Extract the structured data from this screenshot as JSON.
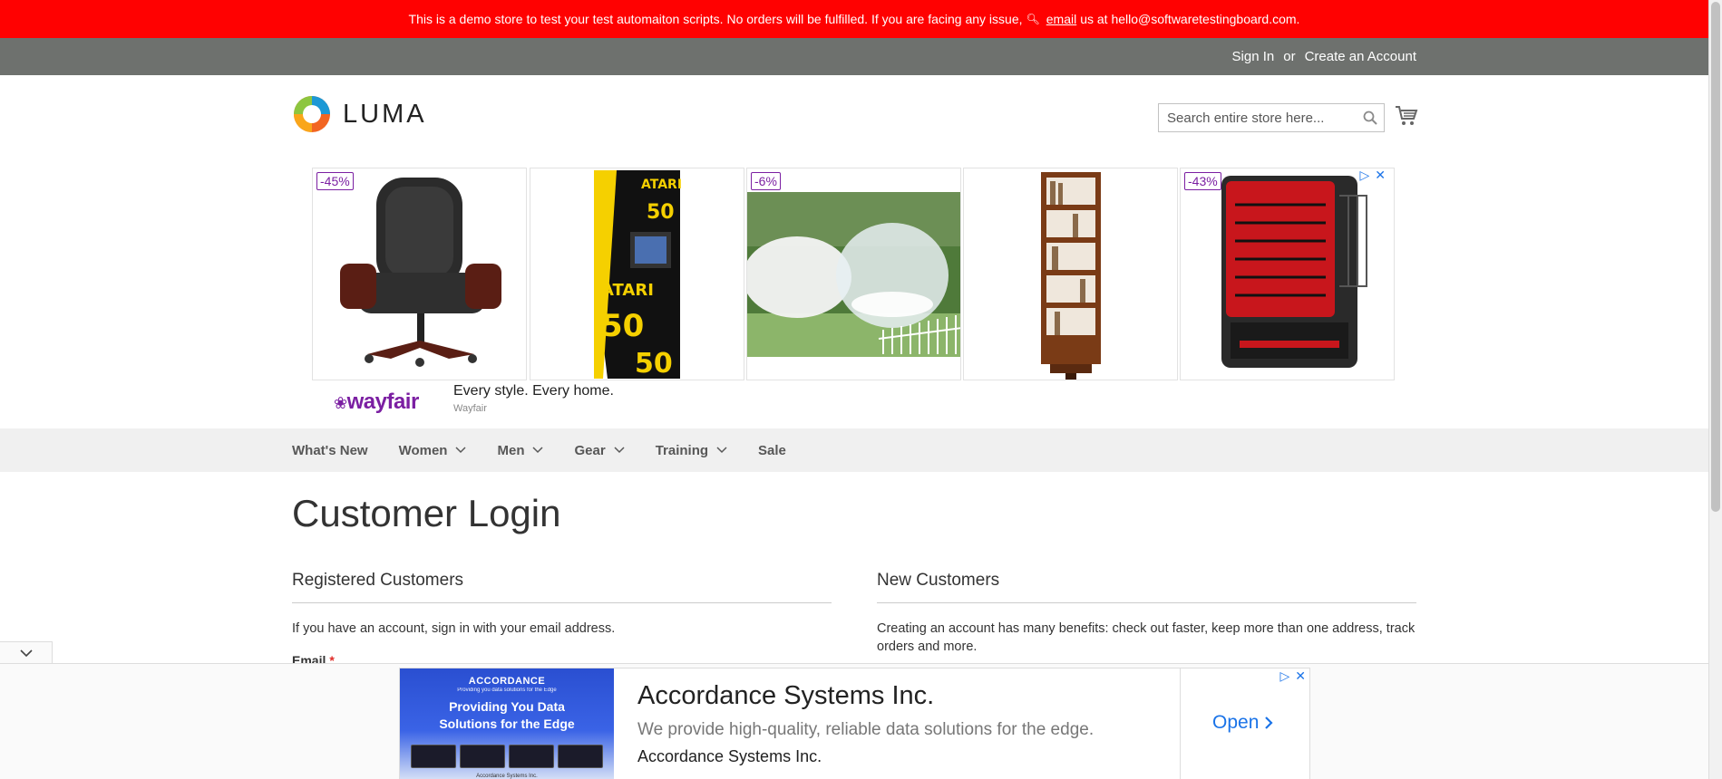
{
  "demo_notice": {
    "text_before": "This is a demo store to test your test automaiton scripts. No orders will be fulfilled. If you are facing any issue,",
    "email_link": "email",
    "text_after": "us at hello@softwaretestingboard.com.",
    "bg_color": "#ff0101"
  },
  "header": {
    "sign_in": "Sign In",
    "or": "or",
    "create_account": "Create an Account"
  },
  "logo": {
    "text": "LUMA"
  },
  "search": {
    "placeholder": "Search entire store here..."
  },
  "top_ad": {
    "tiles": [
      {
        "badge": "-45%",
        "product": "office-chair"
      },
      {
        "badge": "",
        "product": "atari-arcade"
      },
      {
        "badge": "-6%",
        "product": "bubble-tent"
      },
      {
        "badge": "",
        "product": "bookshelf"
      },
      {
        "badge": "-43%",
        "product": "heater"
      }
    ],
    "brand": "wayfair",
    "slogan": "Every style. Every home.",
    "source": "Wayfair"
  },
  "nav": {
    "items": [
      {
        "label": "What's New",
        "has_dropdown": false
      },
      {
        "label": "Women",
        "has_dropdown": true
      },
      {
        "label": "Men",
        "has_dropdown": true
      },
      {
        "label": "Gear",
        "has_dropdown": true
      },
      {
        "label": "Training",
        "has_dropdown": true
      },
      {
        "label": "Sale",
        "has_dropdown": false
      }
    ]
  },
  "page_title": "Customer Login",
  "registered": {
    "title": "Registered Customers",
    "text": "If you have an account, sign in with your email address.",
    "email_label": "Email",
    "required_marker": "*"
  },
  "new_customers": {
    "title": "New Customers",
    "text": "Creating an account has many benefits: check out faster, keep more than one address, track orders and more."
  },
  "sticky_ad": {
    "image_logo": "ACCORDANCE",
    "image_tagline": "Providing you data solutions for the Edge",
    "image_headline_1": "Providing You Data",
    "image_headline_2": "Solutions for the Edge",
    "image_footer": "Accordance Systems Inc.",
    "title": "Accordance Systems Inc.",
    "description": "We provide high-quality, reliable data solutions for the edge.",
    "advertiser": "Accordance Systems Inc.",
    "cta": "Open"
  },
  "colors": {
    "notice_red": "#ff0101",
    "panel_gray": "#6e716e",
    "nav_bg": "#f0f0f0",
    "ad_blue": "#1a73e8",
    "wayfair_purple": "#7b1fa2"
  }
}
